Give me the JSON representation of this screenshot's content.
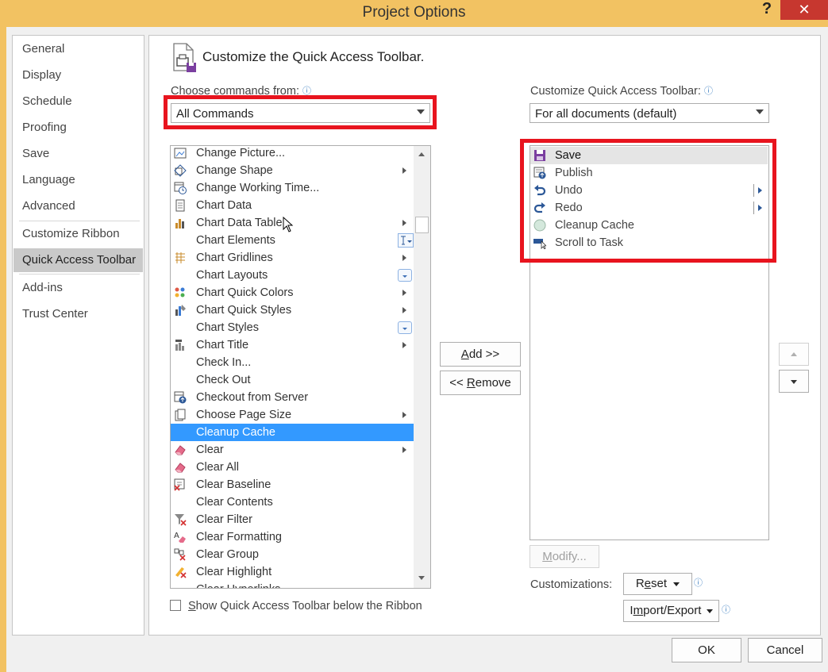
{
  "window": {
    "title": "Project Options",
    "help": "?",
    "close": "✕"
  },
  "nav": {
    "items": [
      {
        "label": "General",
        "active": false
      },
      {
        "label": "Display",
        "active": false
      },
      {
        "label": "Schedule",
        "active": false
      },
      {
        "label": "Proofing",
        "active": false
      },
      {
        "label": "Save",
        "active": false
      },
      {
        "label": "Language",
        "active": false
      },
      {
        "label": "Advanced",
        "active": false
      },
      {
        "label": "Customize Ribbon",
        "active": false
      },
      {
        "label": "Quick Access Toolbar",
        "active": true
      },
      {
        "label": "Add-ins",
        "active": false
      },
      {
        "label": "Trust Center",
        "active": false
      }
    ]
  },
  "main": {
    "heading": "Customize the Quick Access Toolbar.",
    "choose_label": "Choose commands from:",
    "choose_value": "All Commands",
    "qat_label": "Customize Quick Access Toolbar:",
    "qat_scope": "For all documents (default)",
    "commands": [
      {
        "label": "Change Picture...",
        "icon": "picture-icon",
        "suffix": ""
      },
      {
        "label": "Change Shape",
        "icon": "shape-icon",
        "suffix": "submenu"
      },
      {
        "label": "Change Working Time...",
        "icon": "calendar-clock-icon",
        "suffix": ""
      },
      {
        "label": "Chart Data",
        "icon": "chart-data-icon",
        "suffix": ""
      },
      {
        "label": "Chart Data Table",
        "icon": "chart-table-icon",
        "suffix": "submenu"
      },
      {
        "label": "Chart Elements",
        "icon": "",
        "suffix": "split"
      },
      {
        "label": "Chart Gridlines",
        "icon": "gridlines-icon",
        "suffix": "submenu"
      },
      {
        "label": "Chart Layouts",
        "icon": "",
        "suffix": "gallery"
      },
      {
        "label": "Chart Quick Colors",
        "icon": "colors-icon",
        "suffix": "submenu"
      },
      {
        "label": "Chart Quick Styles",
        "icon": "styles-icon",
        "suffix": "submenu"
      },
      {
        "label": "Chart Styles",
        "icon": "",
        "suffix": "gallery"
      },
      {
        "label": "Chart Title",
        "icon": "chart-title-icon",
        "suffix": "submenu"
      },
      {
        "label": "Check In...",
        "icon": "",
        "suffix": ""
      },
      {
        "label": "Check Out",
        "icon": "",
        "suffix": ""
      },
      {
        "label": "Checkout from Server",
        "icon": "server-icon",
        "suffix": ""
      },
      {
        "label": "Choose Page Size",
        "icon": "page-size-icon",
        "suffix": "submenu"
      },
      {
        "label": "Cleanup Cache",
        "icon": "",
        "suffix": "",
        "selected": true
      },
      {
        "label": "Clear",
        "icon": "eraser-icon",
        "suffix": "submenu"
      },
      {
        "label": "Clear All",
        "icon": "eraser-icon",
        "suffix": ""
      },
      {
        "label": "Clear Baseline",
        "icon": "clear-baseline-icon",
        "suffix": ""
      },
      {
        "label": "Clear Contents",
        "icon": "",
        "suffix": ""
      },
      {
        "label": "Clear Filter",
        "icon": "filter-clear-icon",
        "suffix": ""
      },
      {
        "label": "Clear Formatting",
        "icon": "clear-format-icon",
        "suffix": ""
      },
      {
        "label": "Clear Group",
        "icon": "clear-group-icon",
        "suffix": ""
      },
      {
        "label": "Clear Highlight",
        "icon": "clear-highlight-icon",
        "suffix": ""
      },
      {
        "label": "Clear Hyperlinks",
        "icon": "",
        "suffix": ""
      }
    ],
    "add_button": "Add >>",
    "remove_button": "<< Remove",
    "qat_items": [
      {
        "label": "Save",
        "icon": "save-icon",
        "split": false
      },
      {
        "label": "Publish",
        "icon": "publish-icon",
        "split": false
      },
      {
        "label": "Undo",
        "icon": "undo-icon",
        "split": true
      },
      {
        "label": "Redo",
        "icon": "redo-icon",
        "split": true
      },
      {
        "label": "Cleanup Cache",
        "icon": "cache-icon",
        "split": false
      },
      {
        "label": "Scroll to Task",
        "icon": "scroll-task-icon",
        "split": false
      }
    ],
    "modify_button": "Modify...",
    "customizations_label": "Customizations:",
    "reset_button": "Reset",
    "import_export_button": "Import/Export",
    "show_below_label": "Show Quick Access Toolbar below the Ribbon"
  },
  "footer": {
    "ok": "OK",
    "cancel": "Cancel"
  },
  "colors": {
    "highlight": "#e8141e",
    "selection": "#3399ff",
    "title_bar": "#f2c262",
    "close": "#c7372f"
  }
}
